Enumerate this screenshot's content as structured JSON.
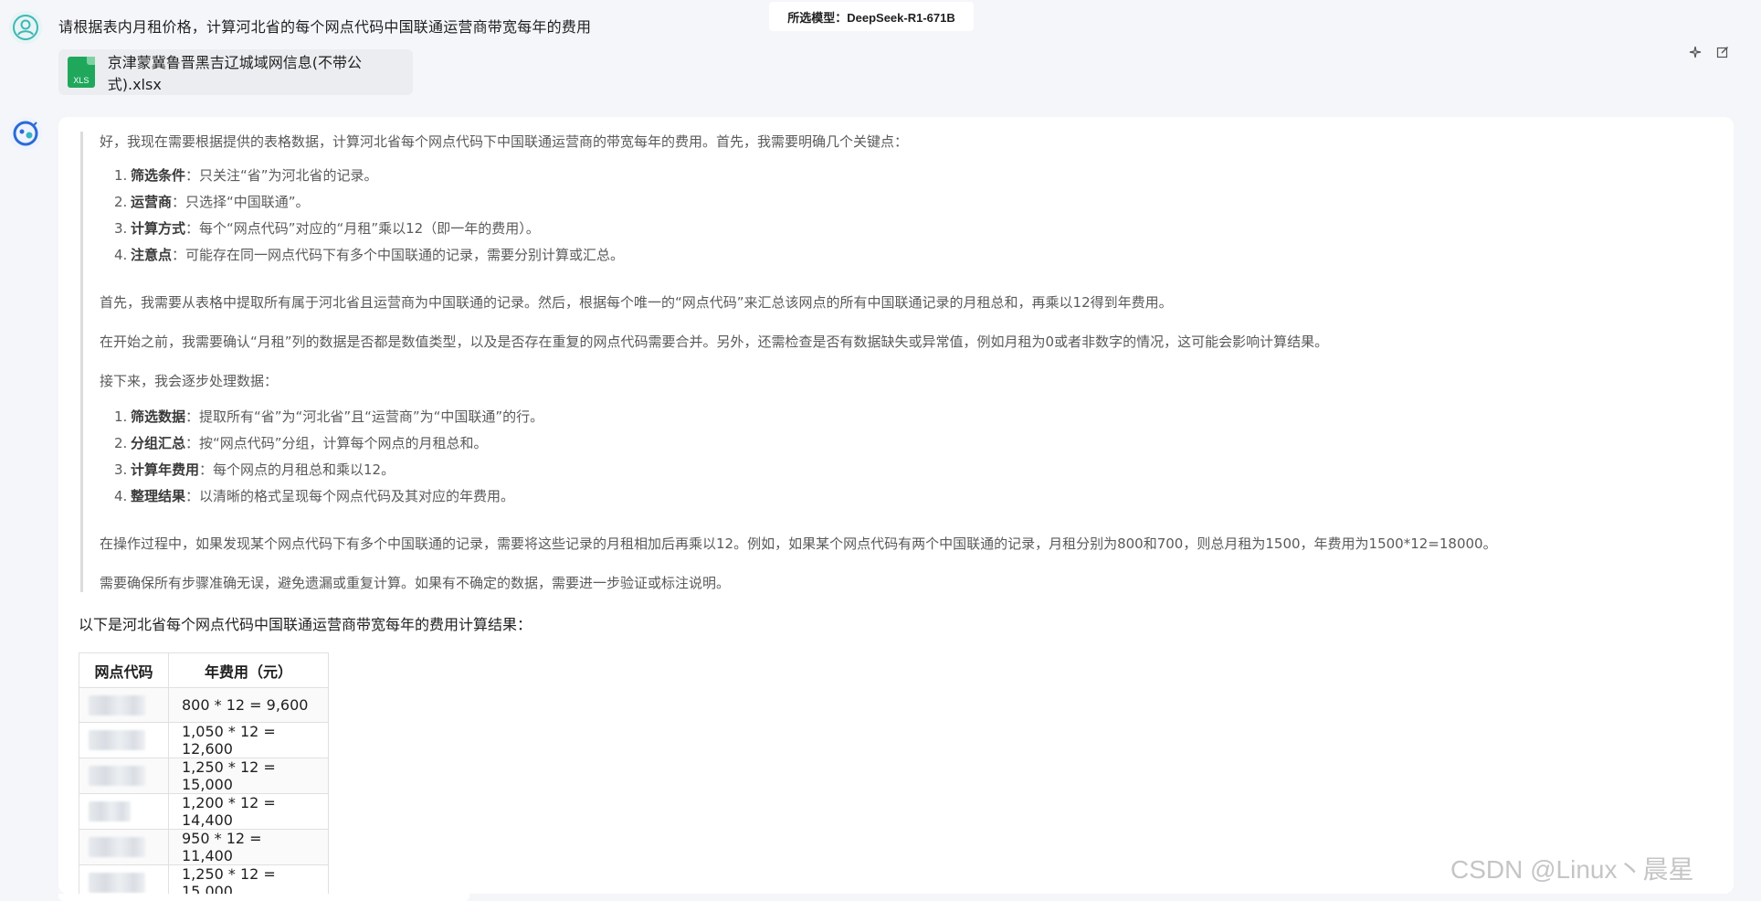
{
  "header": {
    "model_badge": "所选模型：DeepSeek-R1-671B"
  },
  "user_message": {
    "text": "请根据表内月租价格，计算河北省的每个网点代码中国联通运营商带宽每年的费用",
    "attachment": {
      "icon_label": "XLS",
      "file_name": "京津蒙冀鲁晋黑吉辽城域网信息(不带公式).xlsx"
    }
  },
  "thinking": {
    "intro": "好，我现在需要根据提供的表格数据，计算河北省每个网点代码下中国联通运营商的带宽每年的费用。首先，我需要明确几个关键点：",
    "key_points": [
      {
        "num": "1.",
        "bold": "筛选条件",
        "text": "：只关注“省”为河北省的记录。"
      },
      {
        "num": "2.",
        "bold": "运营商",
        "text": "：只选择“中国联通”。"
      },
      {
        "num": "3.",
        "bold": "计算方式",
        "text": "：每个“网点代码”对应的“月租”乘以12（即一年的费用）。"
      },
      {
        "num": "4.",
        "bold": "注意点",
        "text": "：可能存在同一网点代码下有多个中国联通的记录，需要分别计算或汇总。"
      }
    ],
    "para1": "首先，我需要从表格中提取所有属于河北省且运营商为中国联通的记录。然后，根据每个唯一的“网点代码”来汇总该网点的所有中国联通记录的月租总和，再乘以12得到年费用。",
    "para2": "在开始之前，我需要确认“月租”列的数据是否都是数值类型，以及是否存在重复的网点代码需要合并。另外，还需检查是否有数据缺失或异常值，例如月租为0或者非数字的情况，这可能会影响计算结果。",
    "para3": "接下来，我会逐步处理数据：",
    "steps": [
      {
        "num": "1.",
        "bold": "筛选数据",
        "text": "：提取所有“省”为“河北省”且“运营商”为“中国联通”的行。"
      },
      {
        "num": "2.",
        "bold": "分组汇总",
        "text": "：按“网点代码”分组，计算每个网点的月租总和。"
      },
      {
        "num": "3.",
        "bold": "计算年费用",
        "text": "：每个网点的月租总和乘以12。"
      },
      {
        "num": "4.",
        "bold": "整理结果",
        "text": "：以清晰的格式呈现每个网点代码及其对应的年费用。"
      }
    ],
    "para4": "在操作过程中，如果发现某个网点代码下有多个中国联通的记录，需要将这些记录的月租相加后再乘以12。例如，如果某个网点代码有两个中国联通的记录，月租分别为800和700，则总月租为1500，年费用为1500*12=18000。",
    "para5": "需要确保所有步骤准确无误，避免遗漏或重复计算。如果有不确定的数据，需要进一步验证或标注说明。"
  },
  "answer": {
    "summary": "以下是河北省每个网点代码中国联通运营商带宽每年的费用计算结果：",
    "table": {
      "headers": [
        "网点代码",
        "年费用（元）"
      ],
      "rows": [
        "800 * 12 = 9,600",
        "1,050 * 12 = 12,600",
        "1,250 * 12 = 15,000",
        "1,200 * 12 = 14,400",
        "950 * 12 = 11,400",
        "1,250 * 12 = 15,000"
      ]
    }
  },
  "watermark": "CSDN @Linux丶晨星"
}
